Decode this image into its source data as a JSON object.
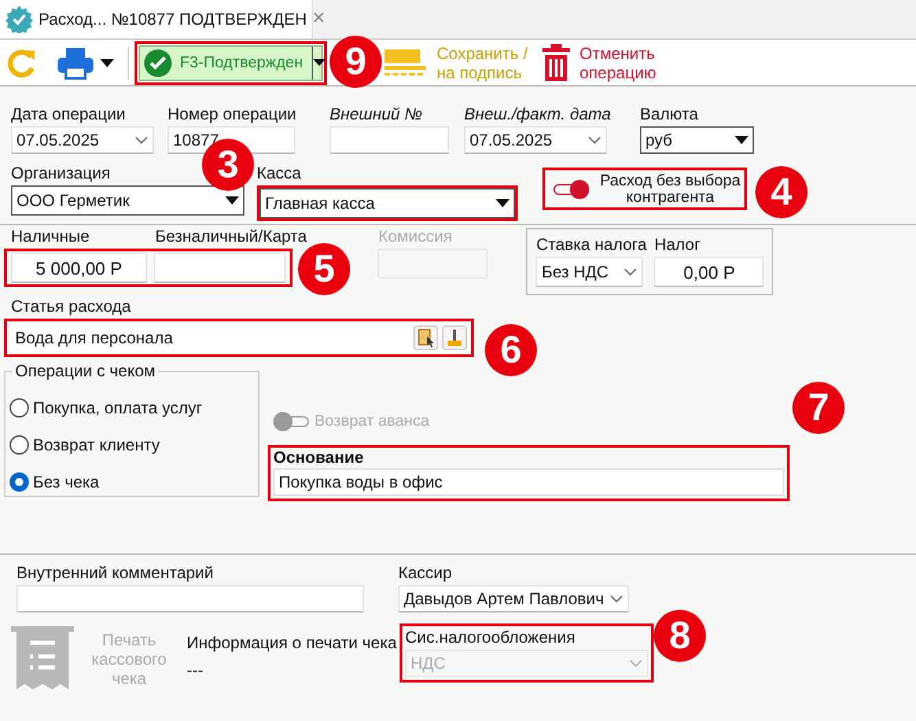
{
  "tab": {
    "title": "Расход... №10877 ПОДТВЕРЖДЕН",
    "close": "×"
  },
  "toolbar": {
    "confirm_button": {
      "label": "F3-Подтвержден",
      "marker": "9"
    },
    "save_button": {
      "label": "Сохранить / на подпись"
    },
    "cancel_button": {
      "label": "Отменить операцию"
    }
  },
  "operation_date": {
    "label": "Дата операции",
    "value": "07.05.2025"
  },
  "operation_number": {
    "label": "Номер операции",
    "value": "10877"
  },
  "external_number": {
    "label": "Внешний №"
  },
  "external_date": {
    "label": "Внеш./факт. дата",
    "value": "07.05.2025"
  },
  "currency": {
    "label": "Валюта",
    "value": "руб"
  },
  "organization": {
    "label": "Организация",
    "value": "ООО Герметик"
  },
  "cash_desk": {
    "label": "Касса",
    "value": "Главная касса",
    "marker": "3"
  },
  "no_counterparty": {
    "label": "Расход без выбора контрагента",
    "on": true,
    "marker": "4"
  },
  "amounts": {
    "marker": "5",
    "cash": {
      "label": "Наличные",
      "value": "5 000,00 Р"
    },
    "cashless": {
      "label": "Безналичный/Карта"
    }
  },
  "commission": {
    "label": "Комиссия",
    "disabled": true
  },
  "tax_rate": {
    "label": "Ставка налога",
    "value": "Без НДС"
  },
  "tax": {
    "label": "Налог",
    "value": "0,00 Р"
  },
  "expense_item": {
    "label": "Статья расхода",
    "value": "Вода для персонала",
    "marker": "6"
  },
  "receipt_operations": {
    "title": "Операции с чеком",
    "options": [
      {
        "label": "Покупка, оплата услуг",
        "selected": false
      },
      {
        "label": "Возврат клиенту",
        "selected": false
      },
      {
        "label": "Без чека",
        "selected": true
      }
    ]
  },
  "advance_return": {
    "label": "Возврат аванса",
    "on": false,
    "disabled": true
  },
  "basis": {
    "label": "Основание",
    "value": "Покупка воды в офис",
    "marker": "7"
  },
  "internal_comment": {
    "label": "Внутренний комментарий"
  },
  "cashier": {
    "label": "Кассир",
    "value": "Давыдов Артем Павлович"
  },
  "print_receipt": {
    "label": "Печать кассового чека",
    "disabled": true
  },
  "print_info": {
    "label": "Информация о печати чека",
    "value": "---"
  },
  "tax_system": {
    "label": "Сис.налогообложения",
    "value": "НДС",
    "disabled": true,
    "marker": "8"
  }
}
